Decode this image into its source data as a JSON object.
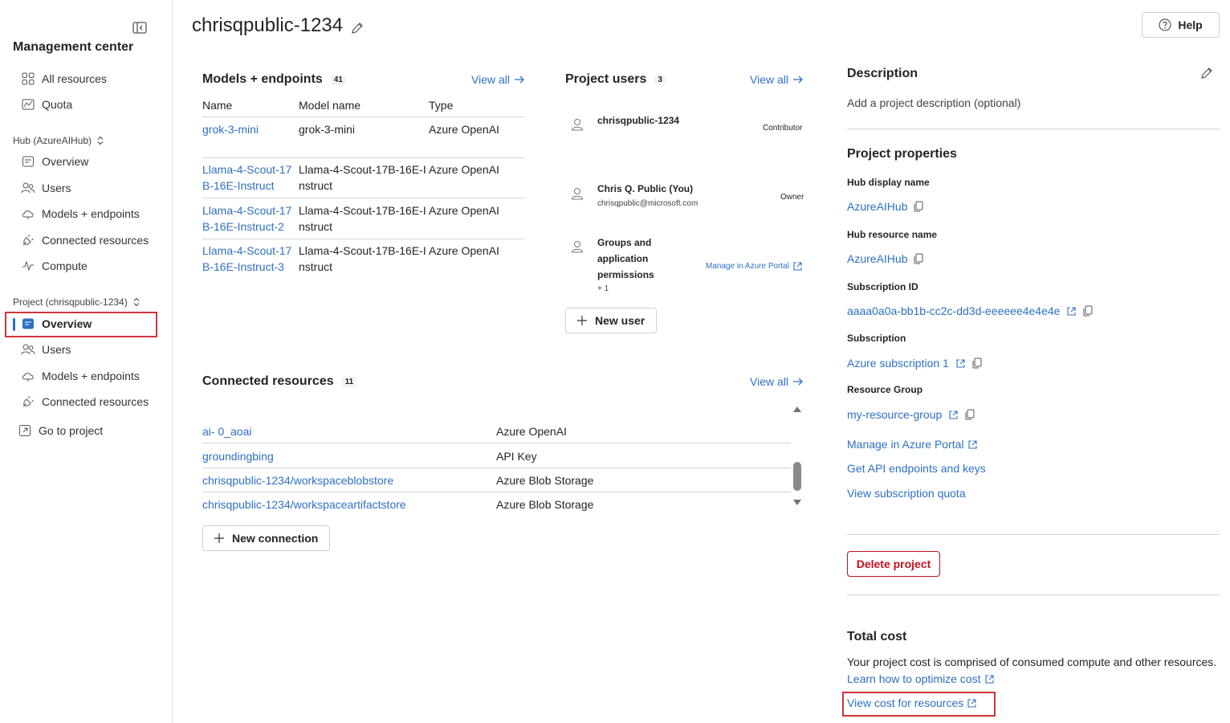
{
  "sidebar": {
    "title": "Management center",
    "top_items": [
      {
        "label": "All resources",
        "icon": "grid-icon"
      },
      {
        "label": "Quota",
        "icon": "gauge-icon"
      }
    ],
    "hub_group": "Hub (AzureAIHub)",
    "hub_items": [
      {
        "label": "Overview",
        "icon": "overview-icon"
      },
      {
        "label": "Users",
        "icon": "users-icon"
      },
      {
        "label": "Models + endpoints",
        "icon": "cloud-icon"
      },
      {
        "label": "Connected resources",
        "icon": "plug-icon"
      },
      {
        "label": "Compute",
        "icon": "pulse-icon"
      }
    ],
    "project_group": "Project (chrisqpublic-1234)",
    "project_items": [
      {
        "label": "Overview",
        "icon": "overview-icon",
        "active": true
      },
      {
        "label": "Users",
        "icon": "users-icon"
      },
      {
        "label": "Models + endpoints",
        "icon": "cloud-icon"
      },
      {
        "label": "Connected resources",
        "icon": "plug-icon"
      }
    ],
    "go_to_project": "Go to project"
  },
  "header": {
    "title": "chrisqpublic-1234",
    "help_label": "Help"
  },
  "models": {
    "title": "Models + endpoints",
    "count": "41",
    "view_all": "View all",
    "columns": [
      "Name",
      "Model name",
      "Type"
    ],
    "rows": [
      {
        "name": "grok-3-mini",
        "model": "grok-3-mini",
        "type": "Azure OpenAI"
      },
      {
        "name": "Llama-4-Scout-17B-16E-Instruct",
        "model": "Llama-4-Scout-17B-16E-Instruct",
        "type": "Azure OpenAI"
      },
      {
        "name": "Llama-4-Scout-17B-16E-Instruct-2",
        "model": "Llama-4-Scout-17B-16E-Instruct",
        "type": "Azure OpenAI"
      },
      {
        "name": "Llama-4-Scout-17B-16E-Instruct-3",
        "model": "Llama-4-Scout-17B-16E-Instruct",
        "type": "Azure OpenAI"
      }
    ]
  },
  "users": {
    "title": "Project users",
    "count": "3",
    "view_all": "View all",
    "items": [
      {
        "name": "chrisqpublic-1234",
        "email": "",
        "role": "Contributor"
      },
      {
        "name": "Chris Q. Public (You)",
        "email": "chrisqpublic@microsoft.com",
        "role": "Owner"
      },
      {
        "name": "Groups and application permissions",
        "extra": "+ 1",
        "role": "Manage in Azure Portal"
      }
    ],
    "new_user": "New user"
  },
  "resources": {
    "title": "Connected resources",
    "count": "11",
    "view_all": "View all",
    "rows": [
      {
        "name": "ai- 0_aoai",
        "type": "Azure OpenAI"
      },
      {
        "name": "groundingbing",
        "type": "API Key"
      },
      {
        "name": "chrisqpublic-1234/workspaceblobstore",
        "type": "Azure Blob Storage"
      },
      {
        "name": "chrisqpublic-1234/workspaceartifactstore",
        "type": "Azure Blob Storage"
      }
    ],
    "new_connection": "New connection"
  },
  "description": {
    "title": "Description",
    "placeholder": "Add a project description (optional)"
  },
  "properties": {
    "title": "Project properties",
    "hub_display_name_label": "Hub display name",
    "hub_display_name": "AzureAIHub",
    "hub_resource_name_label": "Hub resource name",
    "hub_resource_name": "AzureAIHub",
    "subscription_id_label": "Subscription ID",
    "subscription_id": "aaaa0a0a-bb1b-cc2c-dd3d-eeeeee4e4e4e",
    "subscription_label": "Subscription",
    "subscription": "Azure subscription 1",
    "resource_group_label": "Resource Group",
    "resource_group": "my-resource-group",
    "links": [
      "Manage in Azure Portal",
      "Get API endpoints and keys",
      "View subscription quota"
    ]
  },
  "delete_label": "Delete project",
  "cost": {
    "title": "Total cost",
    "text": "Your project cost is comprised of consumed compute and other resources.",
    "learn_link": "Learn how to optimize cost",
    "view_cost_link": "View cost for resources"
  },
  "colors": {
    "link": "#2f6fc4",
    "accent_red": "#d13438",
    "danger": "#c50f1f"
  }
}
